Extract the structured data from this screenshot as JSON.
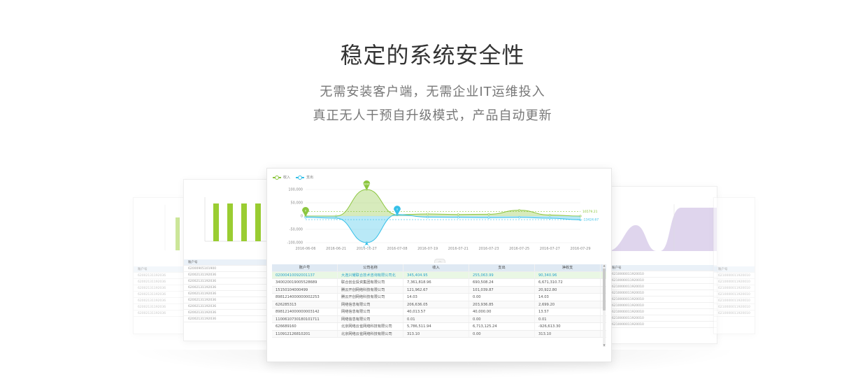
{
  "hero": {
    "title": "稳定的系统安全性",
    "subtitle_line1": "无需安装客户端，无需企业IT运维投入",
    "subtitle_line2": "真正无人干预自升级模式，产品自动更新"
  },
  "colors": {
    "income": "#8cc63f",
    "expense": "#36c0e8",
    "table_header": "#dfe9f3",
    "selected_row": "#e9f7e4",
    "bar_green": "#9acd32",
    "purple_area": "#d7cbe9"
  },
  "main_chart": {
    "legend": [
      "收入",
      "支出"
    ],
    "y_ticks": [
      "100,000",
      "50,000",
      "0",
      "-50,000",
      "-100,000"
    ],
    "x_ticks": [
      "2016-06-06",
      "2016-06-21",
      "2016-06-27",
      "2016-07-08",
      "2016-07-19",
      "2016-07-21",
      "2016-07-23",
      "2016-07-25",
      "2016-07-27",
      "2016-07-29"
    ],
    "markers": [
      "0",
      "20069",
      "0",
      "-11560"
    ],
    "side_labels": [
      "16579.21",
      "-13424.67"
    ]
  },
  "chart_data": {
    "type": "area",
    "x": [
      "2016-06-06",
      "2016-06-21",
      "2016-06-27",
      "2016-07-08",
      "2016-07-19",
      "2016-07-21",
      "2016-07-23",
      "2016-07-25",
      "2016-07-27",
      "2016-07-29"
    ],
    "series": [
      {
        "name": "收入",
        "values": [
          0,
          0,
          100000,
          5000,
          8000,
          6000,
          7000,
          22000,
          4000,
          0
        ]
      },
      {
        "name": "支出",
        "values": [
          -5000,
          -8000,
          -100000,
          6000,
          -4000,
          -5000,
          -6000,
          -5000,
          -8000,
          -14000
        ]
      }
    ],
    "ylim": [
      -100000,
      100000
    ],
    "legend": "top-left",
    "grid": true
  },
  "table": {
    "headers": [
      "账户号",
      "公司名称",
      "收入",
      "支出",
      "净收支"
    ],
    "rows": [
      [
        "02000410092001137",
        "大连兴耀联合技术咨询有限公司北",
        "345,404.95",
        "255,063.99",
        "90,340.96"
      ],
      [
        "340020019005528689",
        "联合创业投资集团有限公司",
        "7,361,818.96",
        "690,508.24",
        "6,671,310.72"
      ],
      [
        "15150104000499",
        "腾云开创网络科技有限公司",
        "121,962.67",
        "101,039.87",
        "20,922.80"
      ],
      [
        "8981214000000002253",
        "腾云开创网络科技有限公司",
        "14.03",
        "0.00",
        "14.03"
      ],
      [
        "626285313",
        "网络信息有限公司",
        "206,636.05",
        "203,936.85",
        "2,699.20"
      ],
      [
        "8981214000000003142",
        "网络信息有限公司",
        "40,013.57",
        "40,000.00",
        "13.57"
      ],
      [
        "1100610730180101711",
        "网络信息有限公司",
        "0.01",
        "0.00",
        "0.01"
      ],
      [
        "626689160",
        "北京网络云雀网络科技有限公司",
        "5,786,511.94",
        "6,713,125.24",
        "-926,613.30"
      ],
      [
        "110912126810201",
        "北京网络云雀网络科技有限公司",
        "313.10",
        "0.00",
        "313.10"
      ]
    ]
  },
  "left_table": {
    "headers": [
      "账户号",
      "账户名称"
    ],
    "rows": [
      "62000905101900",
      "62002131192036",
      "62002131192036",
      "62002131192036",
      "62002131192036",
      "62002131192036",
      "62002131192036",
      "62002131192036",
      "62002131192036",
      "62002131192036"
    ]
  },
  "right_table": {
    "headers": [
      "名称",
      "账户号"
    ],
    "rows": [
      "6210000011920010",
      "6210000011920010",
      "6210000011920010",
      "6210000011920010",
      "6210000011920010",
      "6210000011920010",
      "6210000011920010",
      "6210000011920010",
      "6210000011920010",
      "6210000011920010"
    ]
  }
}
